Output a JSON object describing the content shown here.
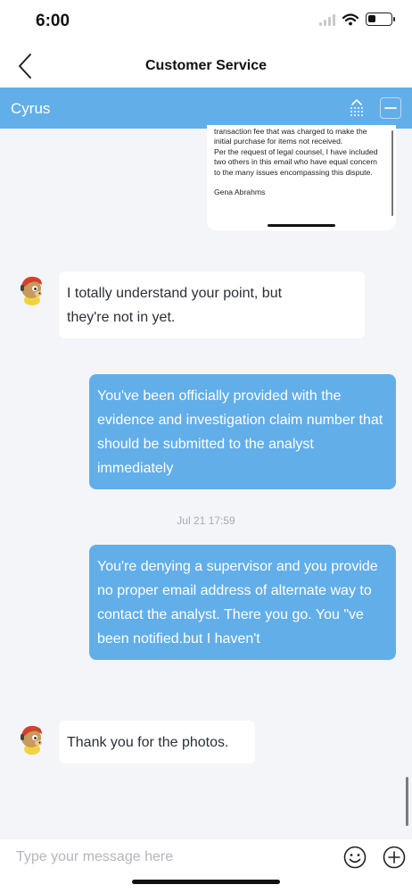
{
  "status_bar": {
    "time": "6:00",
    "icons": [
      "signal-icon",
      "wifi-icon",
      "battery-icon"
    ]
  },
  "nav": {
    "back_icon": "chevron-left-icon",
    "title": "Customer Service"
  },
  "agent_bar": {
    "name": "Cyrus",
    "actions": [
      "rating-icon",
      "minimize-icon"
    ]
  },
  "email_preview": {
    "paragraph_1": "transaction fee that was charged to make the initial purchase for items not received.",
    "paragraph_2": "Per the request of legal counsel, I have included two others in this email who have equal concern to the many issues encompassing this dispute.",
    "signature": "Gena Abrahms"
  },
  "messages": [
    {
      "sender": "agent",
      "text_line1": "I totally understand your point, but",
      "text_line2": "they're not in yet."
    },
    {
      "sender": "user",
      "text": "You've been officially provided with the evidence and investigation claim number that should be submitted to the analyst immediately"
    },
    {
      "sender": "user",
      "text": "You're denying a supervisor and you provide no proper email address of alternate way to contact the analyst. There you go. You \"ve been notified.but I haven't"
    },
    {
      "sender": "agent",
      "text": "Thank you for the photos."
    }
  ],
  "timestamp": "Jul 21 17:59",
  "composer": {
    "placeholder": "Type your message here",
    "value": "",
    "emoji_icon": "emoji-icon",
    "plus_icon": "plus-icon"
  },
  "colors": {
    "accent": "#62aee9",
    "background": "#f3f5f9",
    "bubble_in": "#ffffff",
    "bubble_out": "#62aee9"
  }
}
